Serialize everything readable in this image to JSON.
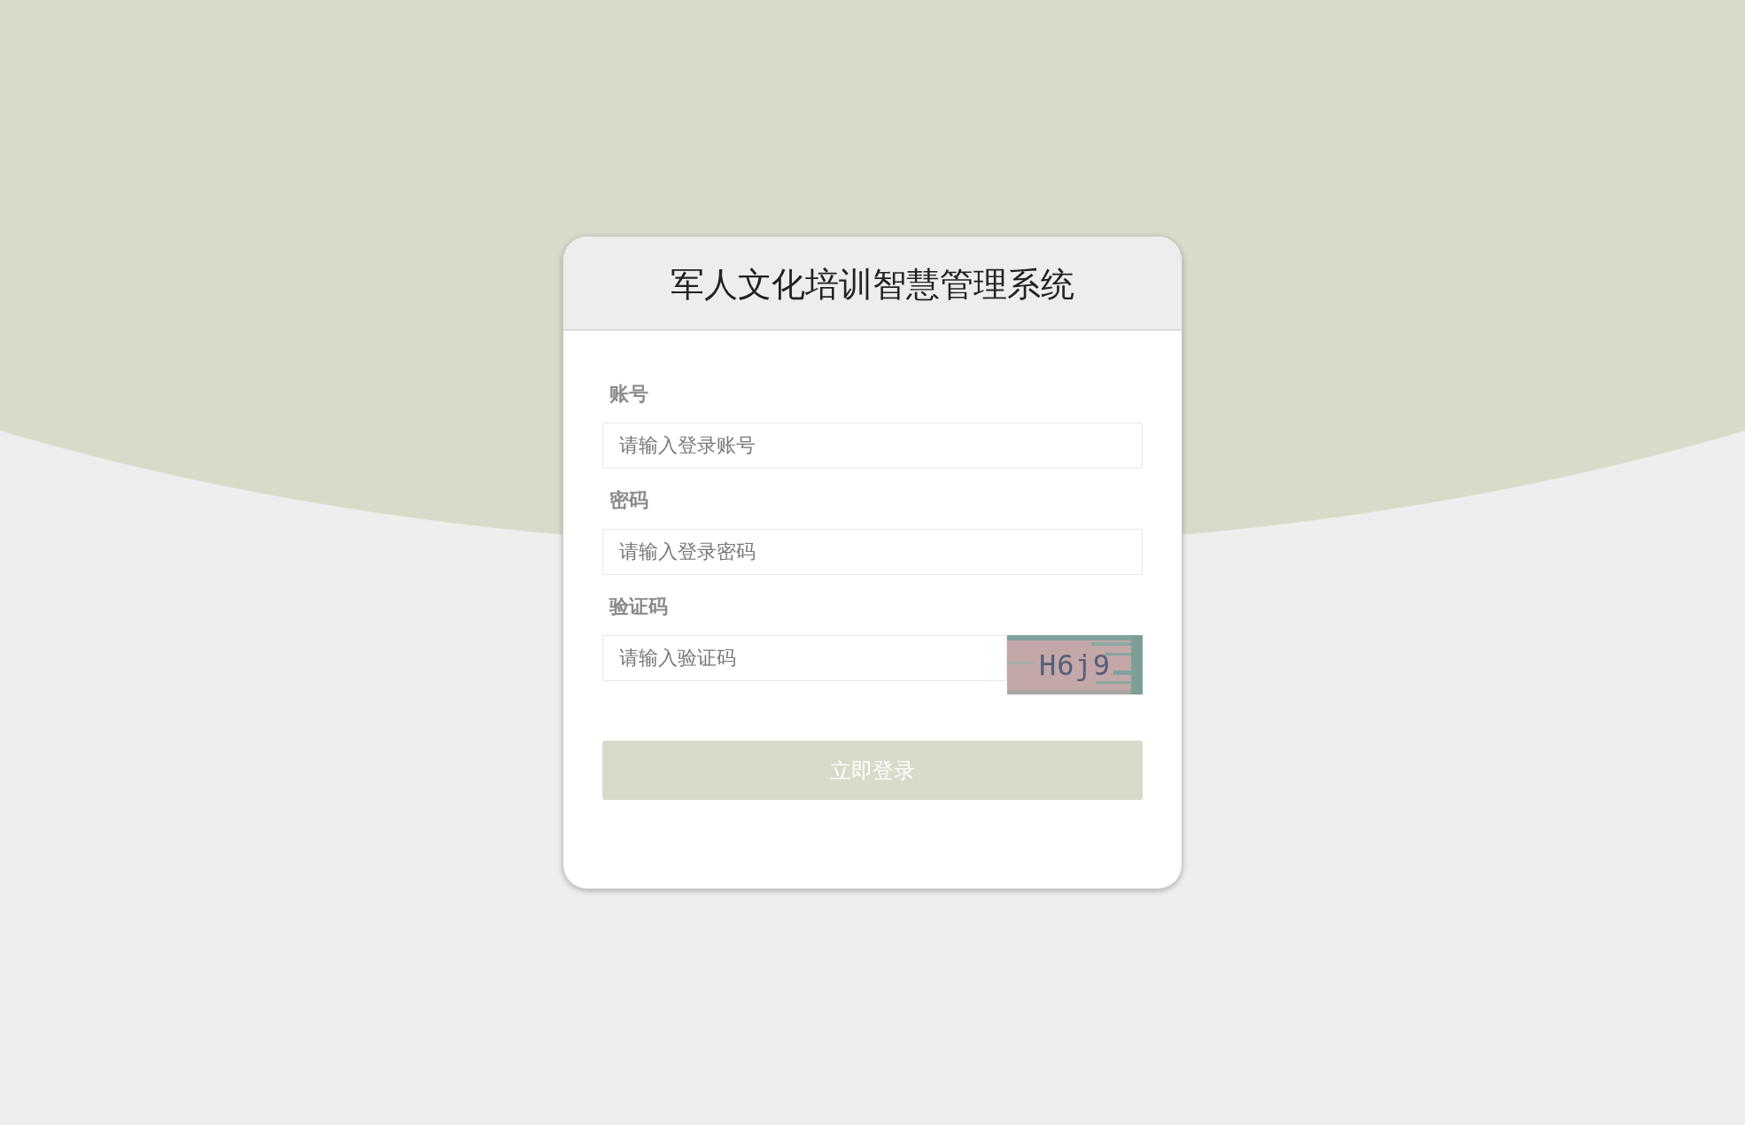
{
  "title": "军人文化培训智慧管理系统",
  "fields": [
    {
      "label": "账号",
      "placeholder": "请输入登录账号",
      "kind": "text"
    },
    {
      "label": "密码",
      "placeholder": "请输入登录密码",
      "kind": "password"
    },
    {
      "label": "验证码",
      "placeholder": "请输入验证码",
      "kind": "captcha",
      "captcha": "H6j9"
    }
  ],
  "submit": {
    "label": "立即登录"
  }
}
